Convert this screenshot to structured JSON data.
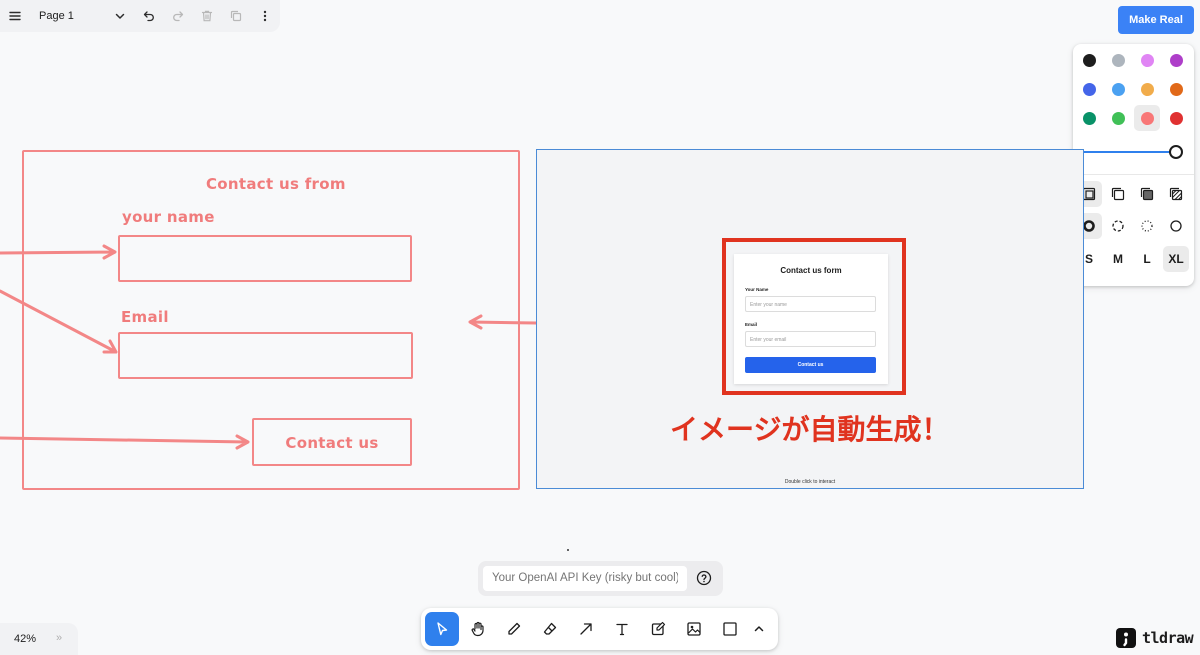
{
  "topbar": {
    "page_name": "Page 1"
  },
  "make_real": {
    "label": "Make Real",
    "color": "#3b82f6"
  },
  "style_panel": {
    "colors": [
      "#1d1d1d",
      "#adb5bd",
      "#e085f4",
      "#ae3ec9",
      "#4465e9",
      "#4ba1f1",
      "#f1ac4b",
      "#e16919",
      "#099268",
      "#40c057",
      "#f87777",
      "#e03131"
    ],
    "selected_color": "#f87777",
    "opacity": 1.0,
    "sizes": [
      "S",
      "M",
      "L",
      "XL"
    ],
    "selected_size": "XL"
  },
  "sketch": {
    "title": "Contact us from",
    "name_label": "your name",
    "email_label": "Email",
    "button_label": "Contact us"
  },
  "preview": {
    "form_title": "Contact us form",
    "name_label": "Your Name",
    "name_placeholder": "Enter your name",
    "email_label": "Email",
    "email_placeholder": "Enter your email",
    "button_label": "Contact us",
    "hint": "Double click to interact"
  },
  "caption": "イメージが自動生成！",
  "api_key": {
    "placeholder": "Your OpenAI API Key (risky but cool)"
  },
  "zoom": {
    "level": "42%"
  },
  "logo": {
    "text": "tldraw"
  }
}
